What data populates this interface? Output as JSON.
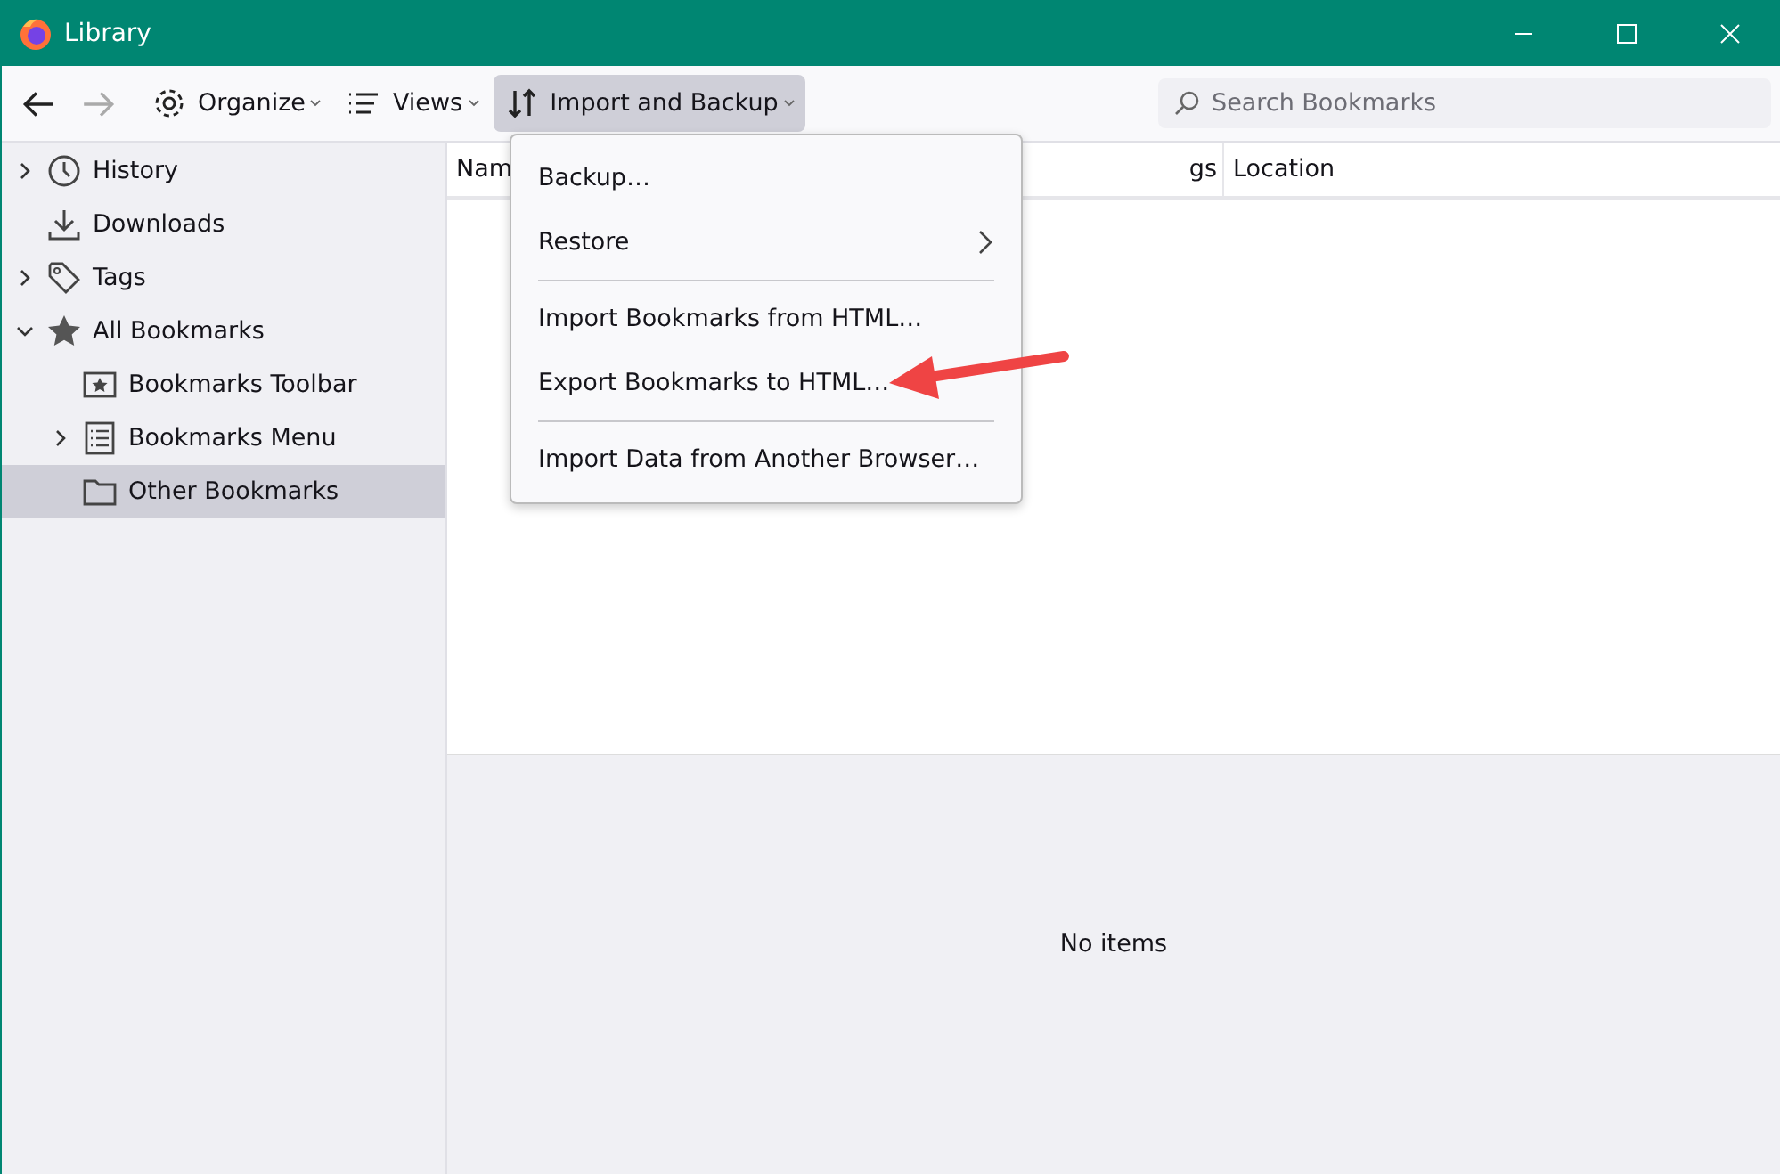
{
  "window": {
    "title": "Library"
  },
  "toolbar": {
    "buttons": [
      {
        "label": "Organize",
        "kind": "gear",
        "selected": false
      },
      {
        "label": "Views",
        "kind": "list",
        "selected": false
      },
      {
        "label": "Import and Backup",
        "kind": "sort",
        "selected": true
      }
    ],
    "search": {
      "placeholder": "Search Bookmarks"
    }
  },
  "sidebar": {
    "items": [
      {
        "label": "History",
        "kind": "clock",
        "expandable": true,
        "expanded": false,
        "selected": false
      },
      {
        "label": "Downloads",
        "kind": "download",
        "expandable": false,
        "selected": false
      },
      {
        "label": "Tags",
        "kind": "tag",
        "expandable": true,
        "expanded": false,
        "selected": false
      },
      {
        "label": "All Bookmarks",
        "kind": "star",
        "expandable": true,
        "expanded": true,
        "selected": false,
        "children": [
          {
            "label": "Bookmarks Toolbar",
            "kind": "toolbar",
            "expandable": false,
            "selected": false
          },
          {
            "label": "Bookmarks Menu",
            "kind": "menu",
            "expandable": true,
            "expanded": false,
            "selected": false
          },
          {
            "label": "Other Bookmarks",
            "kind": "folder",
            "expandable": false,
            "selected": true
          }
        ]
      }
    ]
  },
  "table": {
    "columns": [
      "Nam",
      "gs",
      "Location"
    ]
  },
  "details": {
    "message": "No items"
  },
  "menu": {
    "items": [
      {
        "kind": "item",
        "label": "Backup…"
      },
      {
        "kind": "submenu",
        "label": "Restore"
      },
      {
        "kind": "separator"
      },
      {
        "kind": "item",
        "label": "Import Bookmarks from HTML…"
      },
      {
        "kind": "item",
        "label": "Export Bookmarks to HTML…"
      },
      {
        "kind": "separator"
      },
      {
        "kind": "item",
        "label": "Import Data from Another Browser…"
      }
    ]
  }
}
